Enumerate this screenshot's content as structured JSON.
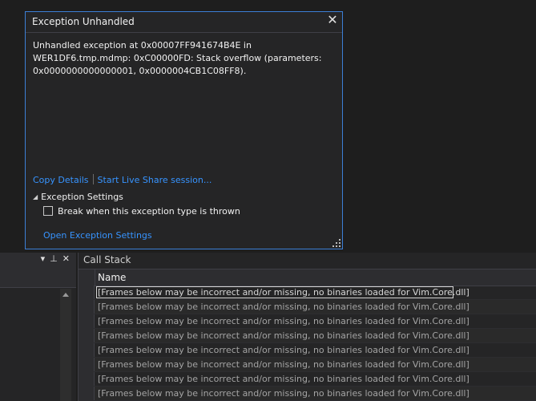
{
  "exception_popup": {
    "title": "Exception Unhandled",
    "message": "Unhandled exception at 0x00007FF941674B4E in\nWER1DF6.tmp.mdmp: 0xC00000FD: Stack overflow (parameters:\n0x0000000000000001, 0x0000004CB1C08FF8).",
    "copy_details": "Copy Details",
    "live_share": "Start Live Share session...",
    "exception_settings_label": "Exception Settings",
    "break_when_thrown": "Break when this exception type is thrown",
    "break_checked": false,
    "open_exception_settings": "Open Exception Settings",
    "border_color": "#3c7fd6",
    "link_color": "#3794ff"
  },
  "left_panel": {
    "tools": [
      "chevron-down-icon",
      "pin-icon",
      "close-icon"
    ]
  },
  "call_stack": {
    "title": "Call Stack",
    "column_name": "Name",
    "rows": [
      "[Frames below may be incorrect and/or missing, no binaries loaded for Vim.Core.dll]",
      "[Frames below may be incorrect and/or missing, no binaries loaded for Vim.Core.dll]",
      "[Frames below may be incorrect and/or missing, no binaries loaded for Vim.Core.dll]",
      "[Frames below may be incorrect and/or missing, no binaries loaded for Vim.Core.dll]",
      "[Frames below may be incorrect and/or missing, no binaries loaded for Vim.Core.dll]",
      "[Frames below may be incorrect and/or missing, no binaries loaded for Vim.Core.dll]",
      "[Frames below may be incorrect and/or missing, no binaries loaded for Vim.Core.dll]",
      "[Frames below may be incorrect and/or missing, no binaries loaded for Vim.Core.dll]"
    ],
    "selected_index": 0
  }
}
